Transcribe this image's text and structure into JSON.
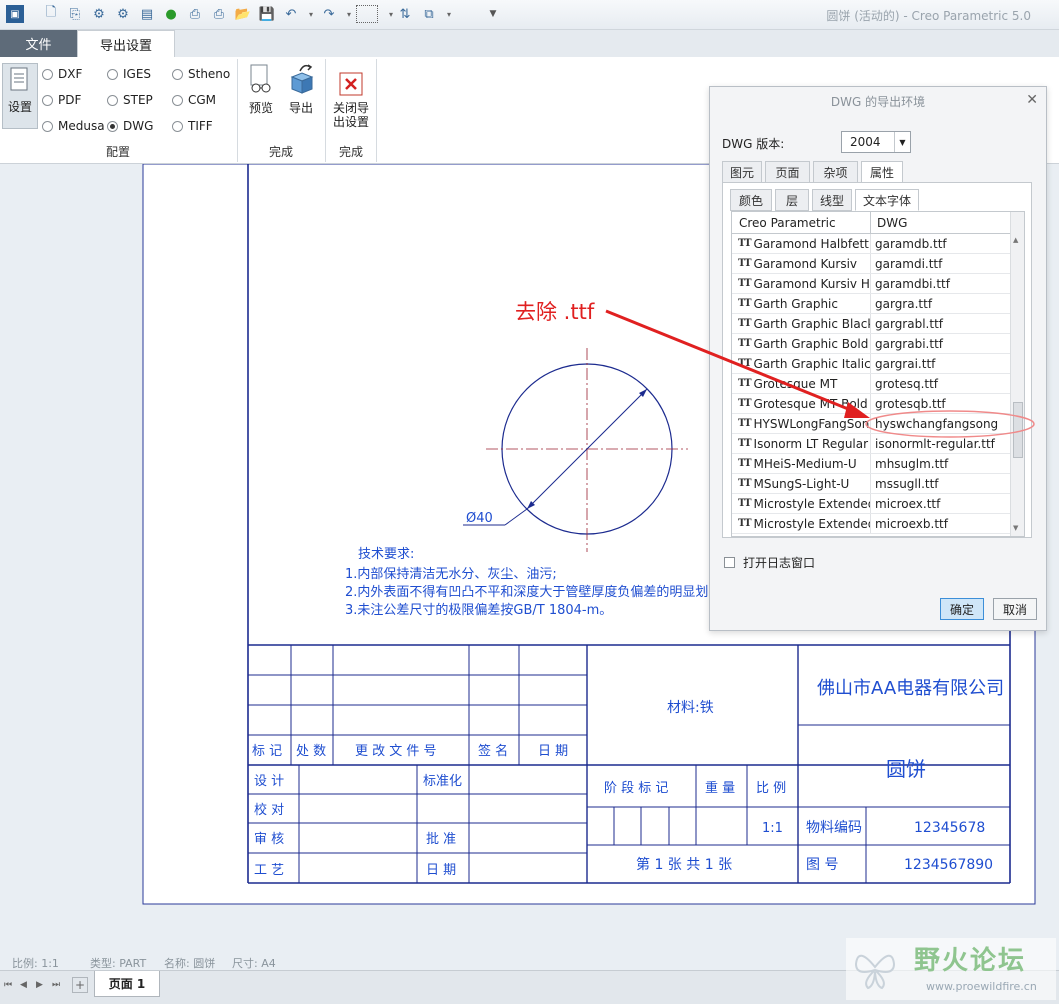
{
  "window": {
    "title": "圆饼 (活动的) - Creo Parametric 5.0"
  },
  "ribbon": {
    "tabs": [
      "文件",
      "导出设置"
    ],
    "settings_label": "设置",
    "formats": [
      {
        "label": "DXF",
        "selected": false
      },
      {
        "label": "IGES",
        "selected": false
      },
      {
        "label": "Stheno",
        "selected": false
      },
      {
        "label": "PDF",
        "selected": false
      },
      {
        "label": "STEP",
        "selected": false
      },
      {
        "label": "CGM",
        "selected": false
      },
      {
        "label": "Medusa",
        "selected": false
      },
      {
        "label": "DWG",
        "selected": true
      },
      {
        "label": "TIFF",
        "selected": false
      }
    ],
    "group_config": "配置",
    "preview_label": "预览",
    "export_label": "导出",
    "group_done1": "完成",
    "close_label_1": "关闭导",
    "close_label_2": "出设置",
    "group_done2": "完成"
  },
  "dialog": {
    "title": "DWG 的导出环境",
    "version_label": "DWG 版本:",
    "version_value": "2004",
    "tabs": [
      "图元",
      "页面",
      "杂项",
      "属性"
    ],
    "subtabs": [
      "颜色",
      "层",
      "线型",
      "文本字体"
    ],
    "col_creo": "Creo Parametric",
    "col_dwg": "DWG",
    "rows": [
      {
        "creo": "Garamond Halbfett",
        "dwg": "garamdb.ttf"
      },
      {
        "creo": "Garamond Kursiv",
        "dwg": "garamdi.ttf"
      },
      {
        "creo": "Garamond Kursiv Halbfett",
        "dwg": "garamdbi.ttf"
      },
      {
        "creo": "Garth Graphic",
        "dwg": "gargra.ttf"
      },
      {
        "creo": "Garth Graphic Black",
        "dwg": "gargrabl.ttf"
      },
      {
        "creo": "Garth Graphic Bold Italic",
        "dwg": "gargrabi.ttf"
      },
      {
        "creo": "Garth Graphic Italic",
        "dwg": "gargrai.ttf"
      },
      {
        "creo": "Grotesque MT",
        "dwg": "grotesq.ttf"
      },
      {
        "creo": "Grotesque MT Bold",
        "dwg": "grotesqb.ttf"
      },
      {
        "creo": "HYSWLongFangSong",
        "dwg": "hyswchangfangsong"
      },
      {
        "creo": "Isonorm LT Regular",
        "dwg": "isonormlt-regular.ttf"
      },
      {
        "creo": "MHeiS-Medium-U",
        "dwg": "mhsuglm.ttf"
      },
      {
        "creo": "MSungS-Light-U",
        "dwg": "mssugll.ttf"
      },
      {
        "creo": "Microstyle Extended",
        "dwg": "microex.ttf"
      },
      {
        "creo": "Microstyle Extended Bold",
        "dwg": "microexb.ttf"
      }
    ],
    "log_label": "打开日志窗口",
    "ok_label": "确定",
    "cancel_label": "取消"
  },
  "annotation": {
    "text": "去除 .ttf",
    "color": "#e02020"
  },
  "drawing": {
    "diameter_label": "Ø40",
    "tech_req": {
      "title": "技术要求:",
      "line1": "1.内部保持清洁无水分、灰尘、油污;",
      "line2": "2.内外表面不得有凹凸不平和深度大于管壁厚度负偏差的明显划",
      "line3": "3.未注公差尺寸的极限偏差按GB/T 1804-m。"
    },
    "title_block": {
      "material": "材料:铁",
      "company": "佛山市AA电器有限公司",
      "part_name": "圆饼",
      "rev_headers": [
        "标 记",
        "处 数",
        "更 改 文 件 号",
        "签 名",
        "日 期"
      ],
      "design": "设 计",
      "standardize": "标准化",
      "check": "校 对",
      "review": "审 核",
      "approve": "批 准",
      "process": "工 艺",
      "date": "日 期",
      "stage": "阶 段 标 记",
      "weight": "重 量",
      "scale_h": "比 例",
      "scale_v": "1:1",
      "material_code_label": "物料编码",
      "material_code": "12345678",
      "sheet": "第 1 张   共 1 张",
      "drawing_no_label": "图    号",
      "drawing_no": "1234567890"
    }
  },
  "status": {
    "scale": "比例: 1:1",
    "type": "类型: PART",
    "name": "名称: 圆饼",
    "size": "尺寸: A4"
  },
  "page_tab": "页面 1",
  "watermark": {
    "logo": "野火论坛",
    "url": "www.proewildfire.cn"
  }
}
